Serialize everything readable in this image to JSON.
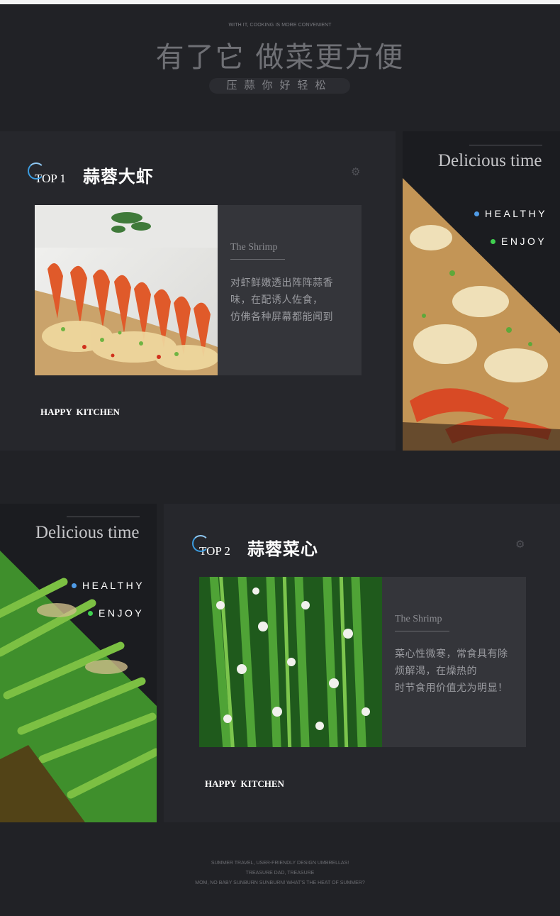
{
  "header": {
    "tagline": "WITH IT, COOKING IS MORE CONVENIENT",
    "title": "有了它 做菜更方便",
    "pill": "压蒜你好轻松"
  },
  "cards": [
    {
      "rank": "TOP 1",
      "name": "蒜蓉大虾",
      "subtitle": "The Shrimp",
      "desc_lines": [
        "对虾鲜嫩透出阵阵蒜香",
        "味，在配诱人佐食，",
        "仿佛各种屏幕都能闻到"
      ],
      "footer": "HAPPY KITCHEN"
    },
    {
      "rank": "TOP 2",
      "name": "蒜蓉菜心",
      "subtitle": "The Shrimp",
      "desc_lines": [
        "菜心性微寒，常食具有除",
        "烦解渴，在燥热的",
        "时节食用价值尤为明显！"
      ],
      "footer": "HAPPY KITCHEN"
    }
  ],
  "side_panels": [
    {
      "title": "Delicious time",
      "tags": [
        "HEALTHY",
        "ENJOY"
      ]
    },
    {
      "title": "Delicious time",
      "tags": [
        "HEALTHY",
        "ENJOY"
      ]
    }
  ],
  "colors": {
    "healthy_dot": "#4f9be6",
    "enjoy_dot": "#3fcf4f",
    "accent_ring": "#3b9ce0"
  },
  "icons": {
    "settings": "gear-icon",
    "rank_badge": "loading-ring-icon"
  },
  "footer_lines": [
    "SUMMER TRAVEL, USER-FRIENDLY DESIGN UMBRELLAS!",
    "TREASURE DAD, TREASURE",
    "MOM, NO BABY SUNBURN SUNBURN! WHAT'S THE HEAT OF SUMMER?"
  ]
}
